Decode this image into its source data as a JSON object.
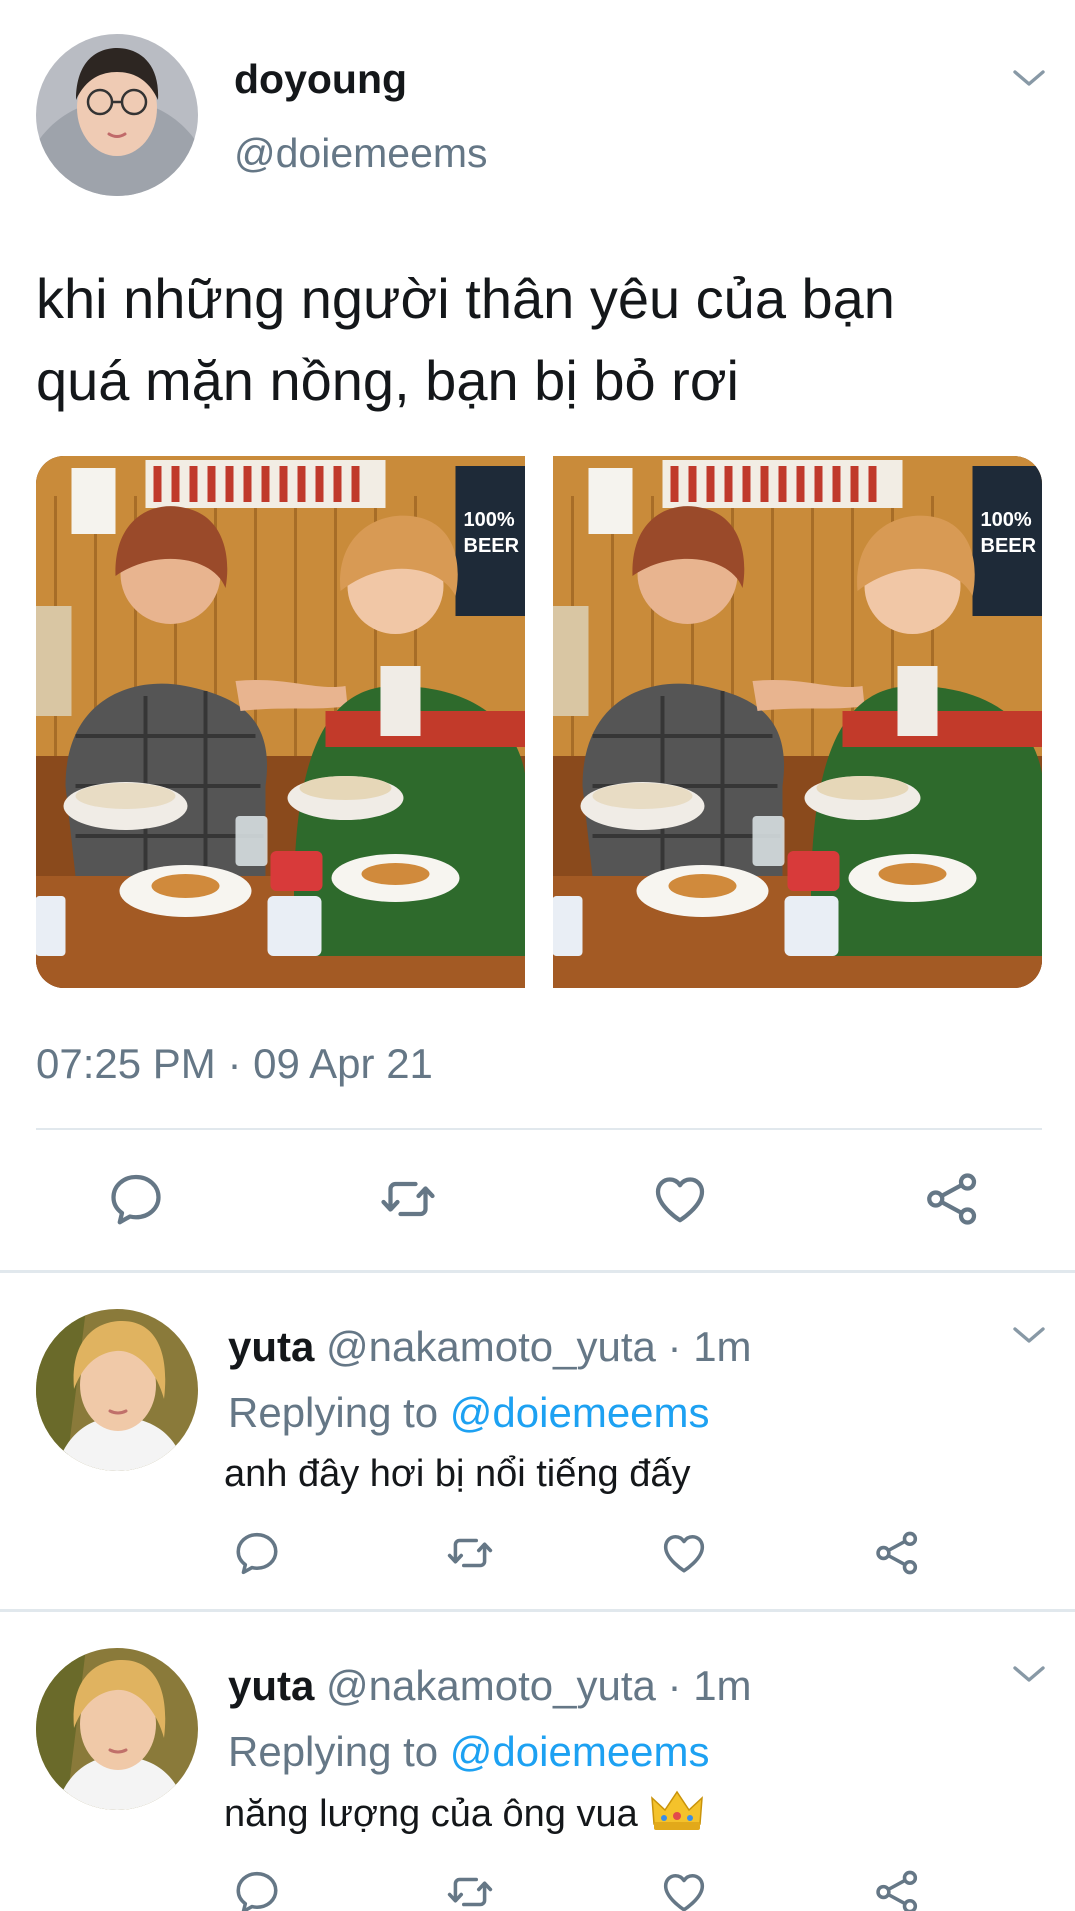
{
  "tweet": {
    "author_name": "doyoung",
    "author_handle": "@doiemeems",
    "text_line1": "khi những người thân yêu của bạn",
    "text_line2": "quá mặn nồng, bạn bị bỏ rơi",
    "timestamp": "07:25 PM · 09 Apr 21",
    "media_count": 2
  },
  "replies": [
    {
      "name": "yuta",
      "handle": "@nakamoto_yuta",
      "dot": "·",
      "time": "1m",
      "replying_prefix": "Replying to ",
      "replying_to": "@doiemeems",
      "text": "anh đây hơi bị nổi tiếng đấy"
    },
    {
      "name": "yuta",
      "handle": "@nakamoto_yuta",
      "dot": "·",
      "time": "1m",
      "replying_prefix": "Replying to ",
      "replying_to": "@doiemeems",
      "text": "năng lượng của ông vua",
      "emoji": "crown-emoji"
    }
  ],
  "icons": {
    "reply": "reply-icon",
    "retweet": "retweet-icon",
    "like": "heart-icon",
    "share": "share-icon",
    "more": "chevron-down-icon"
  },
  "colors": {
    "text": "#14171a",
    "secondary": "#657786",
    "link": "#1da1f2",
    "divider": "#e1e8ed",
    "icon": "#657786"
  }
}
